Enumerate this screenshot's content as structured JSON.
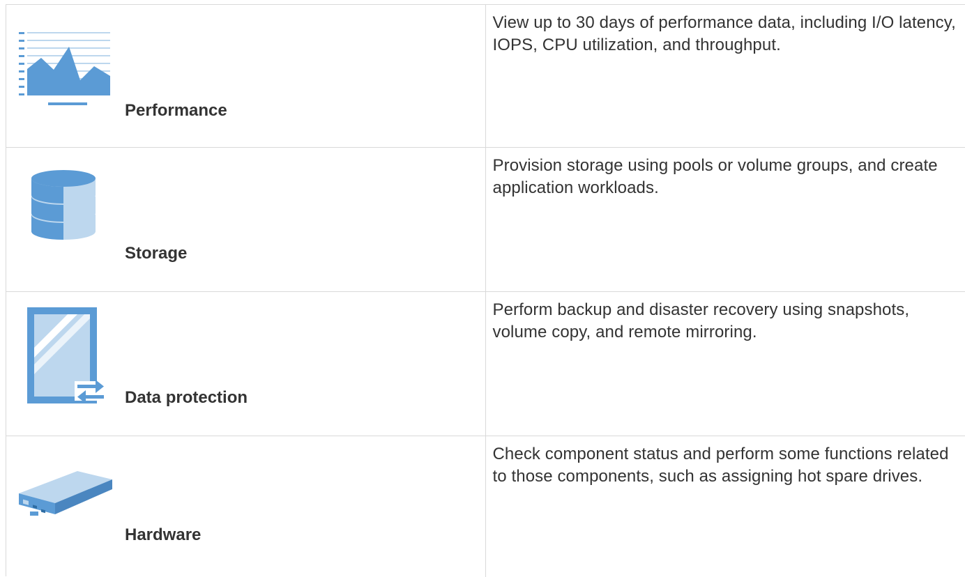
{
  "features": [
    {
      "label": "Performance",
      "icon": "performance-chart-icon",
      "description": "View up to 30 days of performance data, including I/O latency, IOPS, CPU utilization, and throughput."
    },
    {
      "label": "Storage",
      "icon": "database-stack-icon",
      "description": "Provision storage using pools or volume groups, and create application workloads."
    },
    {
      "label": "Data protection",
      "icon": "mirror-arrows-icon",
      "description": "Perform backup and disaster recovery using snapshots, volume copy, and remote mirroring."
    },
    {
      "label": "Hardware",
      "icon": "drive-tray-icon",
      "description": "Check component status and perform some functions related to those components, such as assigning hot spare drives."
    }
  ],
  "colors": {
    "icon_primary": "#5b9bd5",
    "icon_light": "#bdd7ee",
    "border": "#d9d9d9",
    "text": "#333333"
  }
}
